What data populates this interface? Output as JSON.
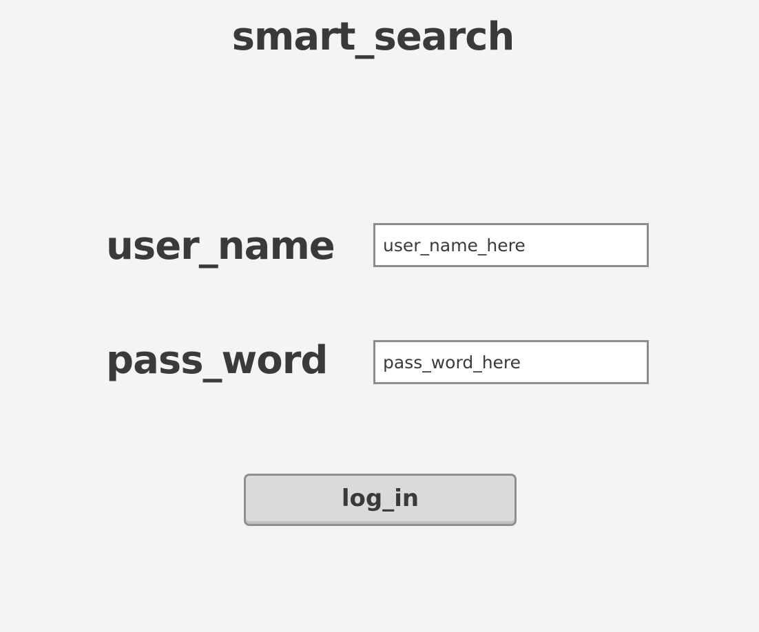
{
  "app": {
    "title": "smart_search"
  },
  "login_form": {
    "username": {
      "label": "user_name",
      "placeholder": "user_name_here",
      "value": ""
    },
    "password": {
      "label": "pass_word",
      "placeholder": "pass_word_here",
      "value": ""
    },
    "submit_label": "log_in"
  },
  "colors": {
    "background": "#f4f4f4",
    "text": "#3a3a3a",
    "input_border": "#8c8c8c",
    "input_background": "#ffffff",
    "button_background": "#dadada",
    "button_border": "#8f8f8f"
  }
}
